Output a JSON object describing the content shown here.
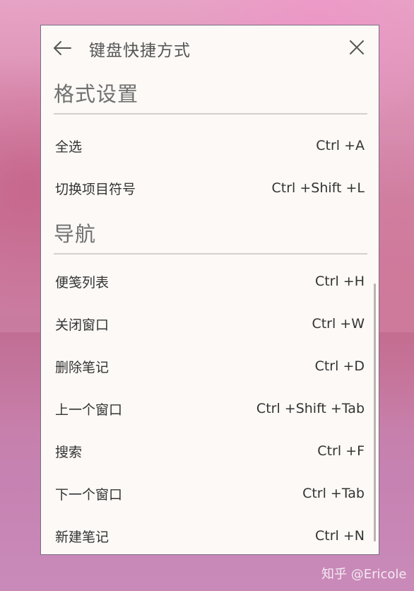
{
  "header": {
    "title": "键盘快捷方式",
    "back_icon": "arrow-left-icon",
    "close_icon": "close-icon"
  },
  "sections": [
    {
      "title": "格式设置",
      "items": [
        {
          "label": "全选",
          "keys": "Ctrl +A"
        },
        {
          "label": "切换项目符号",
          "keys": "Ctrl +Shift +L"
        }
      ]
    },
    {
      "title": "导航",
      "items": [
        {
          "label": "便笺列表",
          "keys": "Ctrl +H"
        },
        {
          "label": "关闭窗口",
          "keys": "Ctrl +W"
        },
        {
          "label": "删除笔记",
          "keys": "Ctrl +D"
        },
        {
          "label": "上一个窗口",
          "keys": "Ctrl +Shift +Tab"
        },
        {
          "label": "搜索",
          "keys": "Ctrl +F"
        },
        {
          "label": "下一个窗口",
          "keys": "Ctrl +Tab"
        },
        {
          "label": "新建笔记",
          "keys": "Ctrl +N"
        }
      ]
    }
  ],
  "watermark": "知乎 @Ericole",
  "colors": {
    "panel_bg": "#fcf9f6",
    "panel_border": "#7a6f86",
    "text": "#333333",
    "section_title": "#707070"
  }
}
